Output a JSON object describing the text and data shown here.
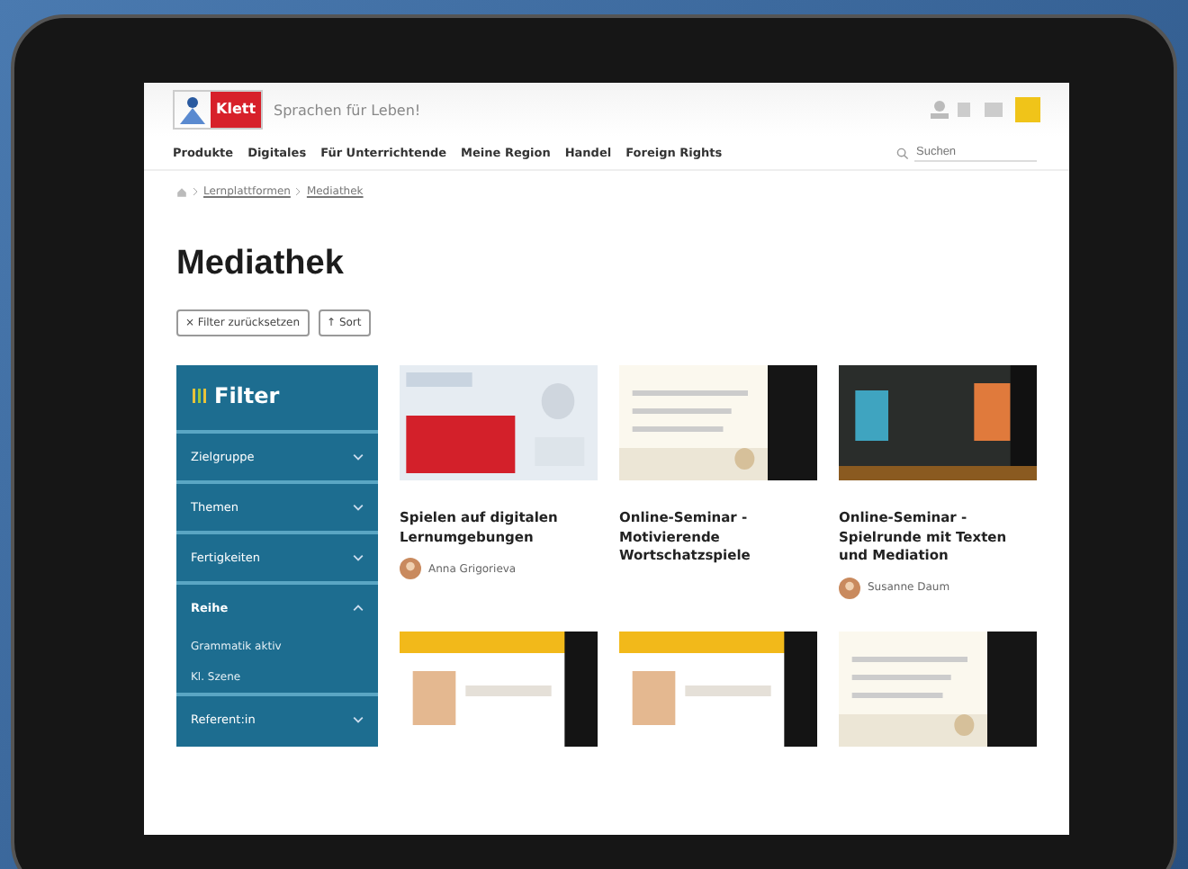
{
  "header": {
    "logo": "Klett",
    "tagline": "Sprachen für Leben!"
  },
  "nav": [
    "Produkte",
    "Digitales",
    "Für Unterrichtende",
    "Meine Region",
    "Handel",
    "Foreign Rights"
  ],
  "search": {
    "placeholder": "Suchen"
  },
  "breadcrumb": [
    "Lernplattformen",
    "Mediathek"
  ],
  "title": "Mediathek",
  "actions": [
    "× Filter zurücksetzen",
    "↑ Sort"
  ],
  "sidebar": {
    "title": "Filter",
    "items": [
      {
        "label": "Zielgruppe",
        "expanded": false
      },
      {
        "label": "Themen",
        "expanded": false
      },
      {
        "label": "Fertigkeiten",
        "expanded": false
      },
      {
        "label": "Reihe",
        "expanded": true,
        "children": [
          {
            "label": "Grammatik aktiv"
          },
          {
            "label": "Kl. Szene"
          }
        ]
      },
      {
        "label": "Referent:in",
        "expanded": false
      }
    ]
  },
  "cards": [
    {
      "title": "Spielen auf digitalen Lernumgebungen",
      "author": "Anna Grigorieva",
      "kind": "picture"
    },
    {
      "title": "Online-Seminar - Motivierende Wortschatzspiele",
      "kind": "picture"
    },
    {
      "title": "Online-Seminar - Spielrunde mit Texten und Mediation",
      "author": "Susanne Daum",
      "kind": "picture"
    },
    {
      "kind": "picture"
    },
    {
      "kind": "picture"
    },
    {
      "kind": "picture"
    }
  ]
}
